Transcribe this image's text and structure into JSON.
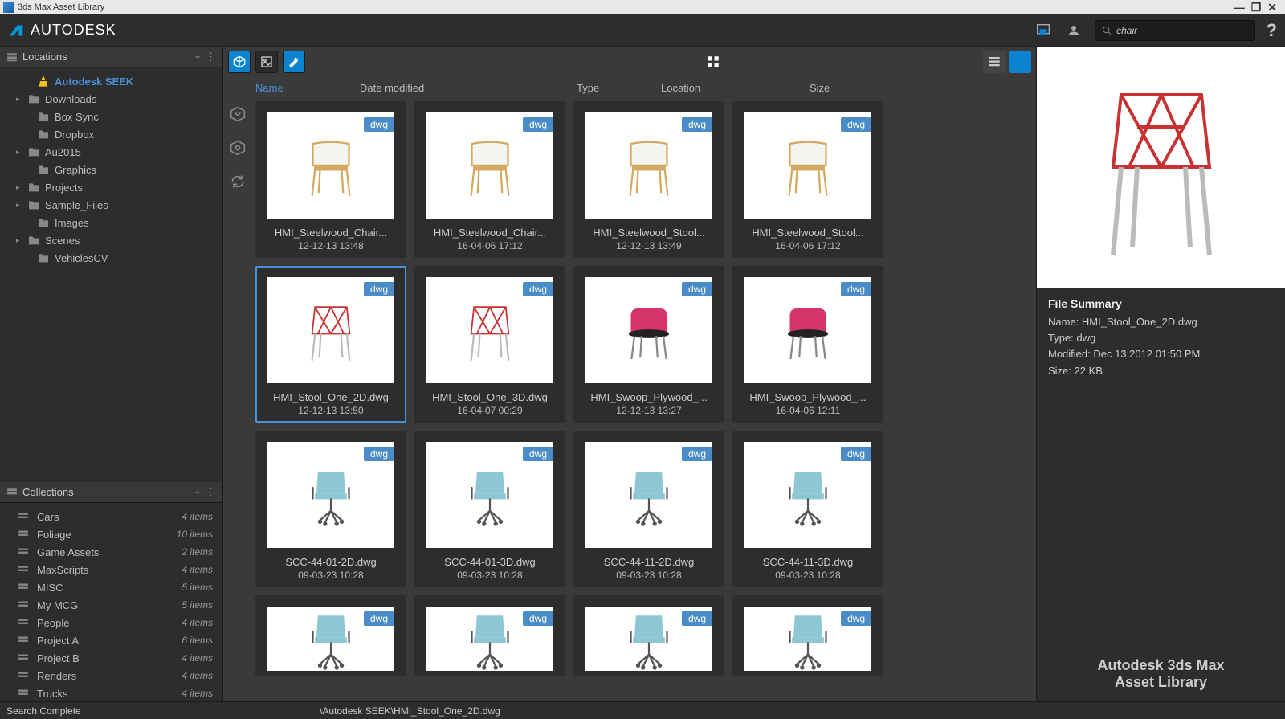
{
  "window": {
    "title": "3ds Max Asset Library"
  },
  "brand": "AUTODESK",
  "search": {
    "value": "chair"
  },
  "sidebar": {
    "locations_label": "Locations",
    "collections_label": "Collections",
    "locations": [
      {
        "label": "Autodesk SEEK",
        "icon": "seek",
        "selected": true,
        "chevron": ""
      },
      {
        "label": "Downloads",
        "icon": "folder",
        "chevron": "▸"
      },
      {
        "label": "Box Sync",
        "icon": "folder",
        "chevron": ""
      },
      {
        "label": "Dropbox",
        "icon": "folder",
        "chevron": ""
      },
      {
        "label": "Au2015",
        "icon": "folder",
        "chevron": "▸"
      },
      {
        "label": "Graphics",
        "icon": "folder",
        "chevron": ""
      },
      {
        "label": "Projects",
        "icon": "folder",
        "chevron": "▸"
      },
      {
        "label": "Sample_Files",
        "icon": "folder",
        "chevron": "▸"
      },
      {
        "label": "Images",
        "icon": "folder",
        "chevron": ""
      },
      {
        "label": "Scenes",
        "icon": "folder",
        "chevron": "▸"
      },
      {
        "label": "VehiclesCV",
        "icon": "folder",
        "chevron": ""
      }
    ],
    "collections": [
      {
        "label": "Cars",
        "count": "4 items"
      },
      {
        "label": "Foliage",
        "count": "10 items"
      },
      {
        "label": "Game Assets",
        "count": "2 items"
      },
      {
        "label": "MaxScripts",
        "count": "4 items"
      },
      {
        "label": "MISC",
        "count": "5 items"
      },
      {
        "label": "My MCG",
        "count": "5 items"
      },
      {
        "label": "People",
        "count": "4 items"
      },
      {
        "label": "Project A",
        "count": "6 items"
      },
      {
        "label": "Project B",
        "count": "4 items"
      },
      {
        "label": "Renders",
        "count": "4 items"
      },
      {
        "label": "Trucks",
        "count": "4 items"
      }
    ]
  },
  "columns": {
    "name": "Name",
    "modified": "Date modified",
    "type": "Type",
    "location": "Location",
    "size": "Size"
  },
  "assets": [
    {
      "name": "HMI_Steelwood_Chair...",
      "date": "12-12-13 13:48",
      "badge": "dwg",
      "style": "wood"
    },
    {
      "name": "HMI_Steelwood_Chair...",
      "date": "16-04-06 17:12",
      "badge": "dwg",
      "style": "wood"
    },
    {
      "name": "HMI_Steelwood_Stool...",
      "date": "12-12-13 13:49",
      "badge": "dwg",
      "style": "wood"
    },
    {
      "name": "HMI_Steelwood_Stool...",
      "date": "16-04-06 17:12",
      "badge": "dwg",
      "style": "wood"
    },
    {
      "name": "HMI_Stool_One_2D.dwg",
      "date": "12-12-13 13:50",
      "badge": "dwg",
      "style": "red",
      "selected": true
    },
    {
      "name": "HMI_Stool_One_3D.dwg",
      "date": "16-04-07 00:29",
      "badge": "dwg",
      "style": "red"
    },
    {
      "name": "HMI_Swoop_Plywood_...",
      "date": "12-12-13 13:27",
      "badge": "dwg",
      "style": "pink"
    },
    {
      "name": "HMI_Swoop_Plywood_...",
      "date": "16-04-06 12:11",
      "badge": "dwg",
      "style": "pink"
    },
    {
      "name": "SCC-44-01-2D.dwg",
      "date": "09-03-23 10:28",
      "badge": "dwg",
      "style": "office"
    },
    {
      "name": "SCC-44-01-3D.dwg",
      "date": "09-03-23 10:28",
      "badge": "dwg",
      "style": "office"
    },
    {
      "name": "SCC-44-11-2D.dwg",
      "date": "09-03-23 10:28",
      "badge": "dwg",
      "style": "office"
    },
    {
      "name": "SCC-44-11-3D.dwg",
      "date": "09-03-23 10:28",
      "badge": "dwg",
      "style": "office"
    },
    {
      "name": "",
      "date": "",
      "badge": "dwg",
      "style": "office",
      "short": true
    },
    {
      "name": "",
      "date": "",
      "badge": "dwg",
      "style": "office",
      "short": true
    },
    {
      "name": "",
      "date": "",
      "badge": "dwg",
      "style": "office",
      "short": true
    },
    {
      "name": "",
      "date": "",
      "badge": "dwg",
      "style": "office",
      "short": true
    }
  ],
  "preview": {
    "title": "File Summary",
    "name_label": "Name: HMI_Stool_One_2D.dwg",
    "type_label": "Type: dwg",
    "modified_label": "Modified: Dec 13 2012 01:50 PM",
    "size_label": "Size: 22 KB",
    "footer_line1": "Autodesk 3ds Max",
    "footer_line2": "Asset Library"
  },
  "status": {
    "left": "Search Complete",
    "path": "\\Autodesk SEEK\\HMI_Stool_One_2D.dwg"
  }
}
